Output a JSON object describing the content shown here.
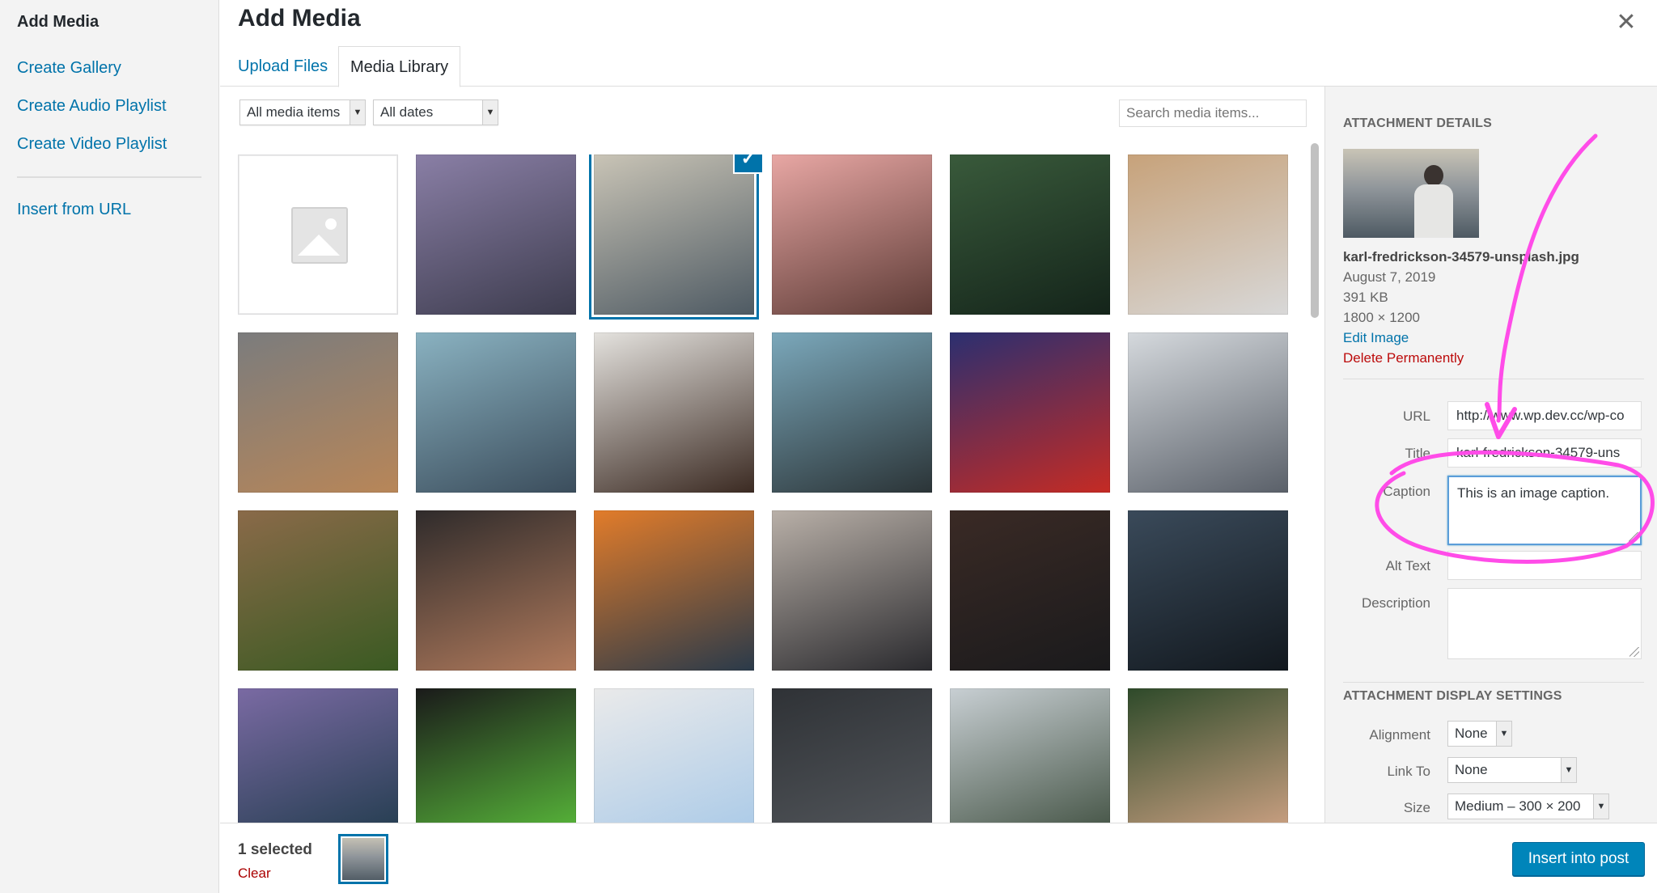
{
  "menu": {
    "items": [
      {
        "label": "Add Media",
        "active": true
      },
      {
        "label": "Create Gallery"
      },
      {
        "label": "Create Audio Playlist"
      },
      {
        "label": "Create Video Playlist"
      }
    ],
    "insert_from_url": "Insert from URL"
  },
  "header": {
    "title": "Add Media",
    "close_icon": "close-icon"
  },
  "tabs": [
    {
      "label": "Upload Files",
      "active": false
    },
    {
      "label": "Media Library",
      "active": true
    }
  ],
  "filters": {
    "type": "All media items",
    "date": "All dates"
  },
  "search": {
    "placeholder": "Search media items..."
  },
  "grid": {
    "items": [
      {
        "name": "placeholder",
        "colors": [
          "#ffffff",
          "#ffffff"
        ],
        "placeholder": true
      },
      {
        "name": "mountain-sunset",
        "colors": [
          "#8a7fa6",
          "#3d3c4e"
        ]
      },
      {
        "name": "man-on-hill",
        "colors": [
          "#c9c4b6",
          "#4e5a63"
        ],
        "selected": true
      },
      {
        "name": "flamingo",
        "colors": [
          "#e8a7a4",
          "#5d3b36"
        ]
      },
      {
        "name": "forest-aerial",
        "colors": [
          "#395a3b",
          "#14241a"
        ]
      },
      {
        "name": "book-kinfolk",
        "colors": [
          "#c7a27a",
          "#d8d8d8"
        ]
      },
      {
        "name": "table-books",
        "colors": [
          "#7b7c7d",
          "#b88658"
        ]
      },
      {
        "name": "woman-redhead",
        "colors": [
          "#8ab2c1",
          "#3b4d5c"
        ]
      },
      {
        "name": "woman-curly",
        "colors": [
          "#e4e2de",
          "#3b2a22"
        ]
      },
      {
        "name": "woman-dark-hair",
        "colors": [
          "#7ba8bb",
          "#2b3437"
        ]
      },
      {
        "name": "beat-fitness",
        "colors": [
          "#2b2f70",
          "#c52b24"
        ]
      },
      {
        "name": "balcony-view",
        "colors": [
          "#d5d9dd",
          "#5a6069"
        ]
      },
      {
        "name": "vegetables",
        "colors": [
          "#8a6a49",
          "#3a5a22"
        ]
      },
      {
        "name": "back-athlete",
        "colors": [
          "#2f2b2b",
          "#b07a5c"
        ]
      },
      {
        "name": "fire",
        "colors": [
          "#e27c2a",
          "#2a3a4a"
        ]
      },
      {
        "name": "bearded-man",
        "colors": [
          "#b9b0a8",
          "#2a2a2e"
        ]
      },
      {
        "name": "woman-portrait",
        "colors": [
          "#3a2a25",
          "#1a1a1c"
        ]
      },
      {
        "name": "milky-way",
        "colors": [
          "#3a4a5a",
          "#12181e"
        ]
      },
      {
        "name": "aurora-purple",
        "colors": [
          "#7a6aa3",
          "#1e3a4a"
        ]
      },
      {
        "name": "aurora-green",
        "colors": [
          "#1a1a1a",
          "#5cc23c"
        ]
      },
      {
        "name": "city-map",
        "colors": [
          "#eaeaea",
          "#a6c8e8"
        ]
      },
      {
        "name": "mission",
        "colors": [
          "#2f3236",
          "#55595e"
        ]
      },
      {
        "name": "hiker-valley",
        "colors": [
          "#c8cfd3",
          "#3a4a3a"
        ]
      },
      {
        "name": "woman-glasses",
        "colors": [
          "#2e4a2a",
          "#d9a88a"
        ]
      }
    ]
  },
  "sidebar": {
    "details_heading": "Attachment Details",
    "filename": "karl-fredrickson-34579-unsplash.jpg",
    "date": "August 7, 2019",
    "size": "391 KB",
    "dimensions": "1800 × 1200",
    "edit_label": "Edit Image",
    "delete_label": "Delete Permanently",
    "fields": {
      "url_label": "URL",
      "url_value": "http://www.wp.dev.cc/wp-co",
      "title_label": "Title",
      "title_value": "karl-fredrickson-34579-uns",
      "caption_label": "Caption",
      "caption_value": "This is an image caption.",
      "alt_label": "Alt Text",
      "alt_value": "",
      "description_label": "Description",
      "description_value": ""
    },
    "display_heading": "Attachment Display Settings",
    "display": {
      "alignment_label": "Alignment",
      "alignment_value": "None",
      "link_label": "Link To",
      "link_value": "None",
      "size_label": "Size",
      "size_value": "Medium – 300 × 200"
    }
  },
  "footer": {
    "selected_count": "1 selected",
    "clear_label": "Clear",
    "insert_label": "Insert into post"
  },
  "colors": {
    "accent": "#0073aa",
    "button": "#0085ba",
    "delete": "#bc0b0b",
    "annotation": "#ff4ce8"
  }
}
